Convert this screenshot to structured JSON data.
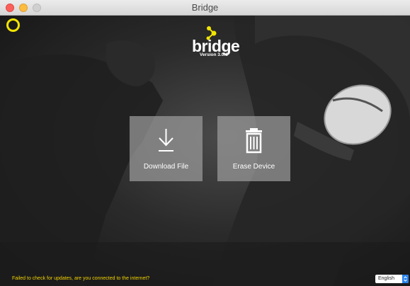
{
  "window": {
    "title": "Bridge"
  },
  "logo": {
    "wordmark": "bridge",
    "version": "Version 3.0.1",
    "icon": "connected-dots-logo"
  },
  "actions": [
    {
      "label": "Download File",
      "icon": "download-icon"
    },
    {
      "label": "Erase Device",
      "icon": "trash-icon"
    }
  ],
  "status": {
    "message": "Failed to check for updates, are you connected to the internet?"
  },
  "language": {
    "selected": "English"
  },
  "colors": {
    "accent_yellow": "#f2e500",
    "status_yellow": "#f2d200",
    "select_blue": "#2b84ec"
  }
}
